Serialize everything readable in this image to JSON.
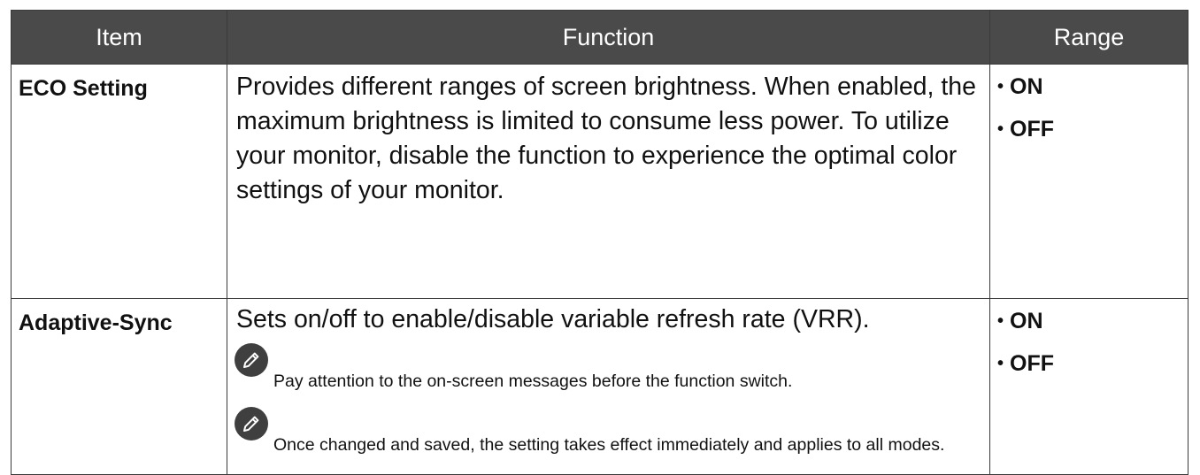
{
  "header": {
    "item": "Item",
    "function": "Function",
    "range": "Range"
  },
  "rows": [
    {
      "item": "ECO Setting",
      "function": "Provides different ranges of screen brightness. When enabled, the maximum brightness is limited to consume less power. To utilize your monitor, disable the function to experience the optimal color settings of your monitor.",
      "range": [
        "ON",
        "OFF"
      ]
    },
    {
      "item": "Adaptive-Sync",
      "function": "Sets on/off to enable/disable variable refresh rate (VRR).",
      "notes": [
        "Pay attention to the on-screen messages before the function switch.",
        "Once changed and saved, the setting takes effect immediately and applies to all modes."
      ],
      "range": [
        "ON",
        "OFF"
      ]
    }
  ],
  "icons": {
    "note": "pencil-note-icon"
  }
}
